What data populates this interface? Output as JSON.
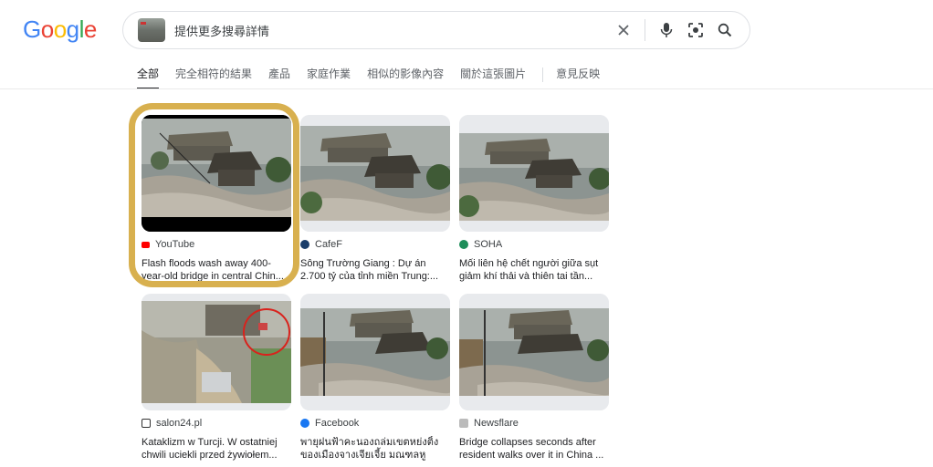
{
  "logo": {
    "letters": [
      "G",
      "o",
      "o",
      "g",
      "l",
      "e"
    ],
    "colors": [
      "#4285f4",
      "#ea4335",
      "#fbbc05",
      "#4285f4",
      "#34a853",
      "#ea4335"
    ]
  },
  "search": {
    "query": "提供更多搜尋詳情"
  },
  "tabs": [
    {
      "label": "全部",
      "active": true
    },
    {
      "label": "完全相符的結果",
      "active": false
    },
    {
      "label": "產品",
      "active": false
    },
    {
      "label": "家庭作業",
      "active": false
    },
    {
      "label": "相似的影像內容",
      "active": false
    },
    {
      "label": "關於這張圖片",
      "active": false
    },
    {
      "label": "意見反映",
      "active": false
    }
  ],
  "results": [
    {
      "source": "YouTube",
      "favicon_color": "#ff0000",
      "title": "Flash floods wash away 400-year-old bridge in central Chin..."
    },
    {
      "source": "CafeF",
      "favicon_color": "#1a3e6b",
      "title": "Sông Trường Giang : Dự án 2.700 tỷ của tỉnh miền Trung:..."
    },
    {
      "source": "SOHA",
      "favicon_color": "#1e8e5a",
      "title": "Mối liên hệ chết người giữa sụt giảm khí thải và thiên tai tần..."
    },
    {
      "source": "salon24.pl",
      "favicon_color": "#333333",
      "title": "Kataklizm w Turcji. W ostatniej chwili uciekli przed żywiołem..."
    },
    {
      "source": "Facebook",
      "favicon_color": "#1877f2",
      "title": "พายุฝนฟ้าคะนองถล่มเขตหย่งติ้ง ของเมืองจางเจียเจี้ย มณฑลหูหน..."
    },
    {
      "source": "Newsflare",
      "favicon_color": "#888888",
      "title": "Bridge collapses seconds after resident walks over it in China ..."
    }
  ]
}
